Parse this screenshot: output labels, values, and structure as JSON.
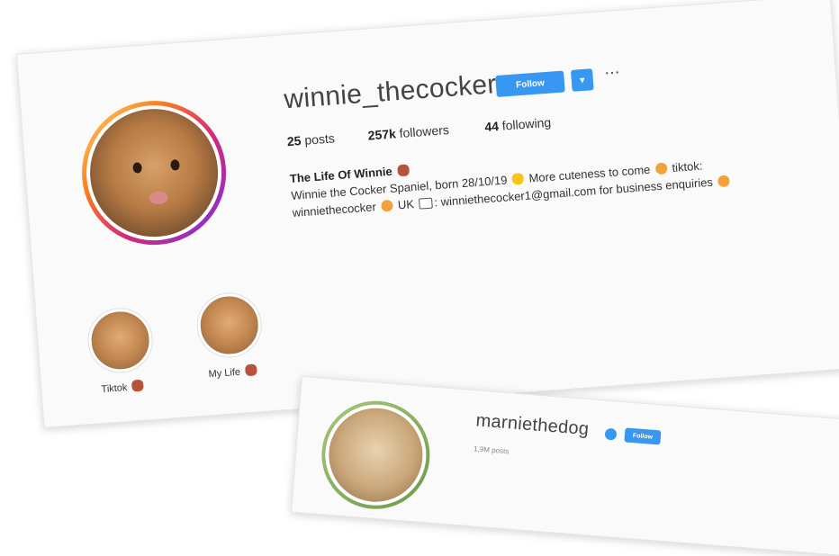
{
  "profile": {
    "username": "winnie_thecocker",
    "follow_label": "Follow",
    "dropdown_glyph": "▾",
    "more_glyph": "···",
    "posts_count": "25",
    "posts_label": "posts",
    "followers_count": "257k",
    "followers_label": "followers",
    "following_count": "44",
    "following_label": "following",
    "bio_name": "The Life Of Winnie",
    "bio_line1": "Winnie the Cocker Spaniel, born 28/10/19",
    "bio_line1b": "More cuteness to come",
    "bio_line1c": "tiktok:",
    "bio_line2a": "winniethecocker",
    "bio_line2b": "UK",
    "bio_line2c": ": winniethecocker1@gmail.com for business enquiries"
  },
  "highlights": [
    {
      "label": "Tiktok"
    },
    {
      "label": "My Life"
    }
  ],
  "second_profile": {
    "username": "marniethedog",
    "follow_label": "Follow",
    "posts_partial": "1,9M posts"
  },
  "colors": {
    "follow_blue": "#3897f0",
    "ring_gradient": [
      "#feda75",
      "#fa7e1e",
      "#d62976",
      "#962fbf"
    ]
  }
}
